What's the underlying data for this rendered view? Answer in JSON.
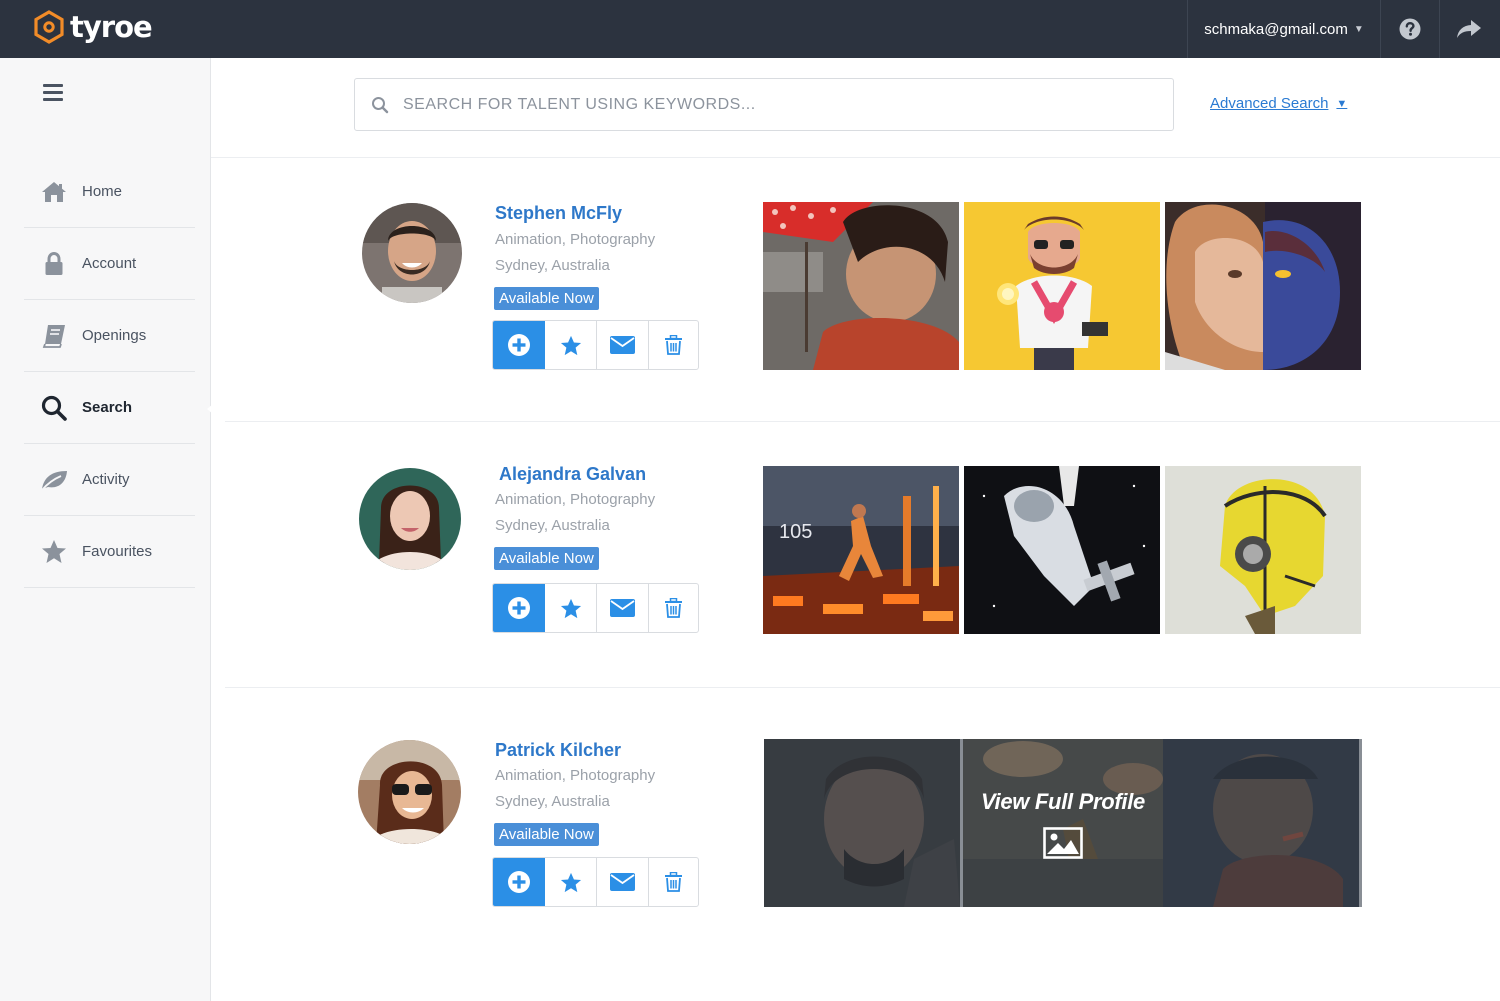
{
  "app": {
    "brand": "tyroe"
  },
  "topbar": {
    "user_email": "schmaka@gmail.com"
  },
  "sidebar": {
    "items": [
      {
        "label": "Home",
        "icon": "home-icon"
      },
      {
        "label": "Account",
        "icon": "lock-icon"
      },
      {
        "label": "Openings",
        "icon": "book-icon"
      },
      {
        "label": "Search",
        "icon": "search-icon",
        "active": true
      },
      {
        "label": "Activity",
        "icon": "leaf-icon"
      },
      {
        "label": "Favourites",
        "icon": "star-icon"
      }
    ]
  },
  "search": {
    "placeholder": "SEARCH FOR TALENT USING KEYWORDS...",
    "advanced_label": "Advanced Search"
  },
  "results": [
    {
      "name": "Stephen McFly",
      "skills": "Animation, Photography",
      "location": "Sydney, Australia",
      "badge": "Available Now"
    },
    {
      "name": "Alejandra Galvan",
      "skills": "Animation, Photography",
      "location": "Sydney, Australia",
      "badge": "Available Now",
      "thumb_text": "105"
    },
    {
      "name": "Patrick Kilcher",
      "skills": "Animation, Photography",
      "location": "Sydney, Australia",
      "badge": "Available Now",
      "overlay_label": "View Full Profile"
    }
  ],
  "colors": {
    "accent": "#2b8fe6",
    "link": "#2e78c9",
    "badge": "#4a8fd8",
    "topbar": "#2c333f",
    "logo": "#f28c28"
  }
}
